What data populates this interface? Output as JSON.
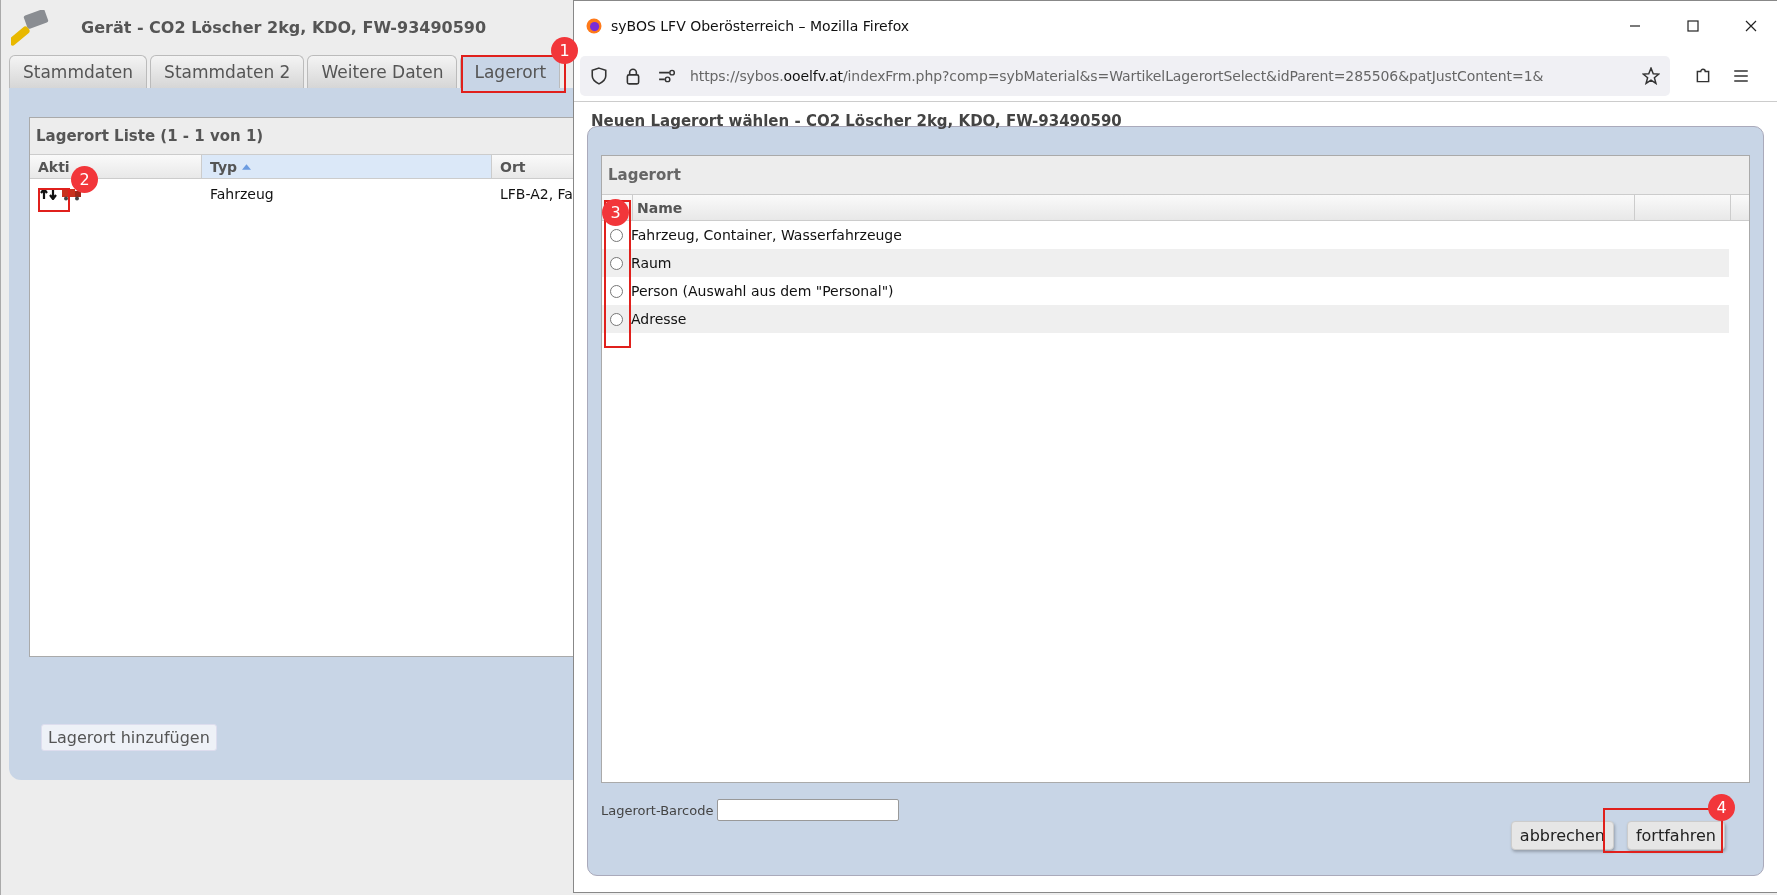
{
  "app": {
    "title": "Gerät - CO2 Löscher 2kg, KDO, FW-93490590",
    "tabs": [
      {
        "label": "Stammdaten",
        "selected": false
      },
      {
        "label": "Stammdaten 2",
        "selected": false
      },
      {
        "label": "Weitere Daten",
        "selected": false
      },
      {
        "label": "Lagerort",
        "selected": true
      }
    ],
    "list": {
      "title": "Lagerort Liste (1 - 1 von 1)",
      "columns": [
        {
          "label": "Akti",
          "sorted": false
        },
        {
          "label": "Typ",
          "sorted": true
        },
        {
          "label": "Ort",
          "sorted": false
        }
      ],
      "rows": [
        {
          "type": "Fahrzeug",
          "place": "LFB-A2, Fa"
        }
      ]
    },
    "add_button": "Lagerort hinzufügen"
  },
  "browser": {
    "title": "syBOS LFV Oberösterreich – Mozilla Firefox",
    "url": {
      "scheme": "https://sybos.",
      "domain": "ooelfv.at",
      "path": "/indexFrm.php?comp=sybMaterial&s=WartikelLagerortSelect&idParent=285506&patJustContent=1&"
    }
  },
  "dialog": {
    "title": "Neuen Lagerort wählen - CO2 Löscher 2kg, KDO, FW-93490590",
    "section": "Lagerort",
    "column": "Name",
    "options": [
      {
        "label": "Fahrzeug, Container, Wasserfahrzeuge",
        "selected": false
      },
      {
        "label": "Raum",
        "selected": false
      },
      {
        "label": "Person (Auswahl aus dem \"Personal\")",
        "selected": false
      },
      {
        "label": "Adresse",
        "selected": false
      }
    ],
    "barcode_label": "Lagerort-Barcode",
    "buttons": [
      {
        "label": "abbrechen"
      },
      {
        "label": "fortfahren"
      }
    ]
  },
  "annotations": [
    {
      "number": "1"
    },
    {
      "number": "2"
    },
    {
      "number": "3"
    },
    {
      "number": "4"
    }
  ]
}
